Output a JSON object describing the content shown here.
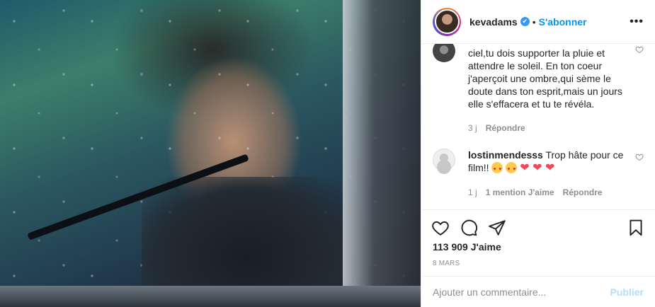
{
  "header": {
    "username": "kevadams",
    "verified_mark": "✔",
    "separator": "•",
    "follow_label": "S'abonner",
    "more_label": "•••"
  },
  "comments": [
    {
      "text": "ciel,tu dois supporter la pluie et attendre le soleil. En ton coeur j'aperçoit une ombre,qui sème le doute dans ton esprit,mais un jours elle s'effacera et tu te révéla.",
      "time": "3 j",
      "reply_label": "Répondre"
    },
    {
      "username": "lostinmendesss",
      "text": "Trop hâte pour ce film!!",
      "emoji_hearts": "❤ ❤ ❤",
      "time": "1 j",
      "likes_label": "1 mention J'aime",
      "reply_label": "Répondre"
    }
  ],
  "post": {
    "likes": "113 909 J'aime",
    "date": "8 MARS"
  },
  "add_comment": {
    "placeholder": "Ajouter un commentaire...",
    "post_label": "Publier"
  },
  "colors": {
    "accent": "#0095f6",
    "verified": "#3897f0",
    "muted": "#8e8e8e",
    "heart": "#ed4956"
  }
}
